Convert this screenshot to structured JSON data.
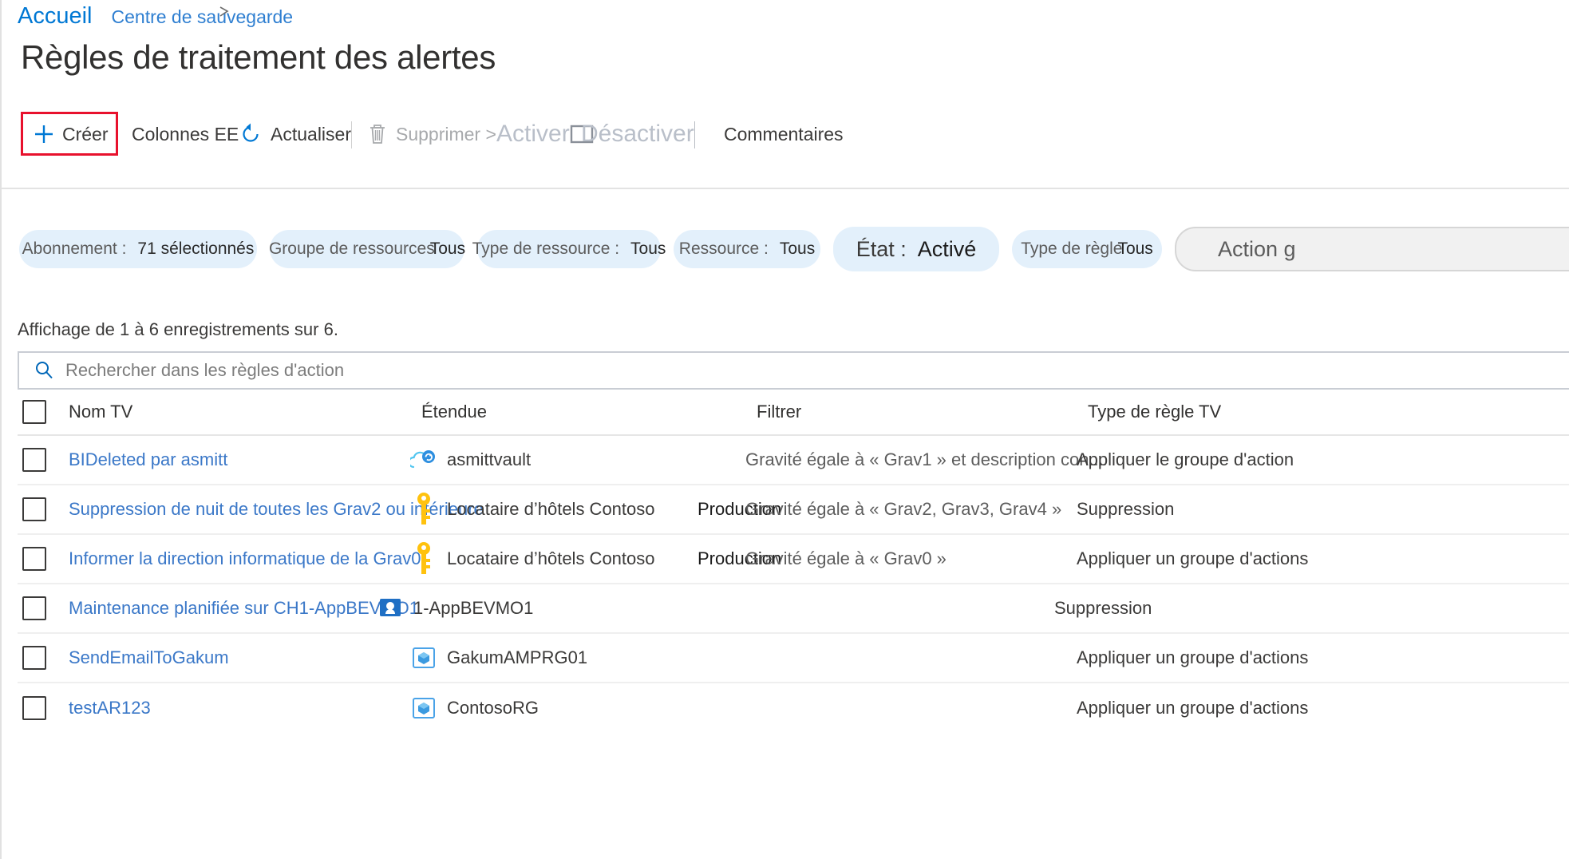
{
  "breadcrumb": {
    "home": "Accueil",
    "link": "Centre de sauvegarde"
  },
  "page_title": "Règles de traitement des alertes",
  "toolbar": {
    "create": "Créer",
    "columns": "Colonnes EE",
    "refresh": "Actualiser",
    "delete": "Supprimer >",
    "enable": "Activer",
    "disable": "Désactiver",
    "feedback": "Commentaires"
  },
  "filters": [
    {
      "key": "Abonnement :",
      "value": "71 sélectionnés",
      "style": "normal"
    },
    {
      "key": "Groupe de ressources",
      "value": "Tous",
      "style": "tight"
    },
    {
      "key": "Type de ressource :",
      "value": "Tous",
      "style": "normal"
    },
    {
      "key": "Ressource :",
      "value": "Tous",
      "style": "normal"
    },
    {
      "key": "État :",
      "value": "Activé",
      "style": "big"
    },
    {
      "key": "Type de règle",
      "value": "Tous",
      "style": "tight"
    },
    {
      "key": "Action g",
      "value": "",
      "style": "disabled"
    }
  ],
  "results_count": "Affichage de 1 à 6 enregistrements sur 6.",
  "search": {
    "placeholder": "Rechercher dans les règles d'action",
    "value": ""
  },
  "table": {
    "columns": [
      "Nom TV",
      "Étendue",
      "Filtrer",
      "Type de règle TV"
    ],
    "rows": [
      {
        "name": "BIDeleted par asmitt",
        "scope": "asmittvault",
        "scope_icon": "recovery-vault-icon",
        "scope_extra": "",
        "filter": "Gravité égale à « Grav1 » et description con...",
        "type": "Appliquer le groupe d'action"
      },
      {
        "name": "Suppression de nuit de toutes les Grav2 ou inférieure",
        "scope": "Locataire d’hôtels Contoso",
        "scope_icon": "key-icon",
        "scope_extra": "Production",
        "filter": "Gravité égale à « Grav2, Grav3, Grav4 »",
        "type": "Suppression"
      },
      {
        "name": "Informer la direction informatique de la Grav0",
        "scope": "Locataire d’hôtels Contoso",
        "scope_icon": "key-icon",
        "scope_extra": "Production",
        "filter": "Gravité égale à « Grav0 »",
        "type": "Appliquer un groupe d'actions"
      },
      {
        "name": "Maintenance planifiée sur CH1-AppBEVMO1",
        "scope": "1-AppBEVMO1",
        "scope_icon": "virtual-machine-icon",
        "scope_extra": "",
        "filter": "",
        "type": "Suppression"
      },
      {
        "name": "SendEmailToGakum",
        "scope": "GakumAMPRG01",
        "scope_icon": "resource-group-icon",
        "scope_extra": "",
        "filter": "",
        "type": "Appliquer un groupe d'actions"
      },
      {
        "name": "testAR123",
        "scope": "ContosoRG",
        "scope_icon": "resource-group-icon",
        "scope_extra": "",
        "filter": "",
        "type": "Appliquer un groupe d'actions"
      }
    ]
  },
  "colors": {
    "link": "#0078d4",
    "highlight": "#e8112d",
    "pill_bg": "#e3f0fb",
    "accent_blue": "#3b78c8"
  }
}
